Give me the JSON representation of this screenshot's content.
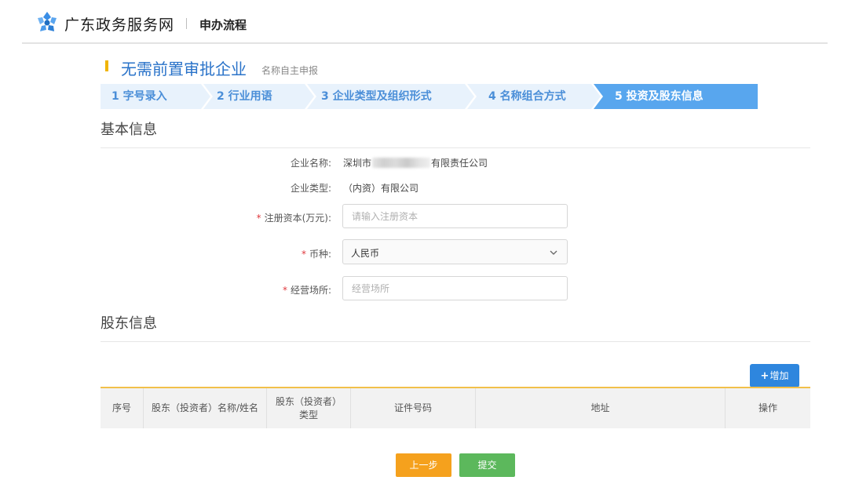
{
  "header": {
    "site_name": "广东政务服务网",
    "page_title": "申办流程"
  },
  "section": {
    "title": "无需前置审批企业",
    "subtitle": "名称自主申报"
  },
  "steps": [
    {
      "label": "1 字号录入",
      "active": false
    },
    {
      "label": "2 行业用语",
      "active": false
    },
    {
      "label": "3 企业类型及组织形式",
      "active": false
    },
    {
      "label": "4 名称组合方式",
      "active": false
    },
    {
      "label": "5 投资及股东信息",
      "active": true
    }
  ],
  "basic_info": {
    "title": "基本信息",
    "company_name_label": "企业名称:",
    "company_name_prefix": "深圳市",
    "company_name_suffix": "有限责任公司",
    "company_type_label": "企业类型:",
    "company_type_value": "（内资）有限公司",
    "capital_label": "注册资本(万元):",
    "capital_placeholder": "请输入注册资本",
    "currency_label": "币种:",
    "currency_value": "人民币",
    "address_label": "经营场所:",
    "address_placeholder": "经营场所",
    "required_mark": "*"
  },
  "shareholder_info": {
    "title": "股东信息",
    "add_button": "增加",
    "add_icon": "+",
    "columns": [
      "序号",
      "股东（投资者）名称/姓名",
      "股东（投资者）类型",
      "证件号码",
      "地址",
      "操作"
    ]
  },
  "actions": {
    "prev": "上一步",
    "submit": "提交"
  },
  "colors": {
    "accent_blue": "#2e86de",
    "step_bg": "#e8f2fc",
    "step_active": "#58a6ee",
    "prev_button": "#f5a11d",
    "submit_button": "#5cb85c",
    "table_border": "#f2c04a"
  }
}
